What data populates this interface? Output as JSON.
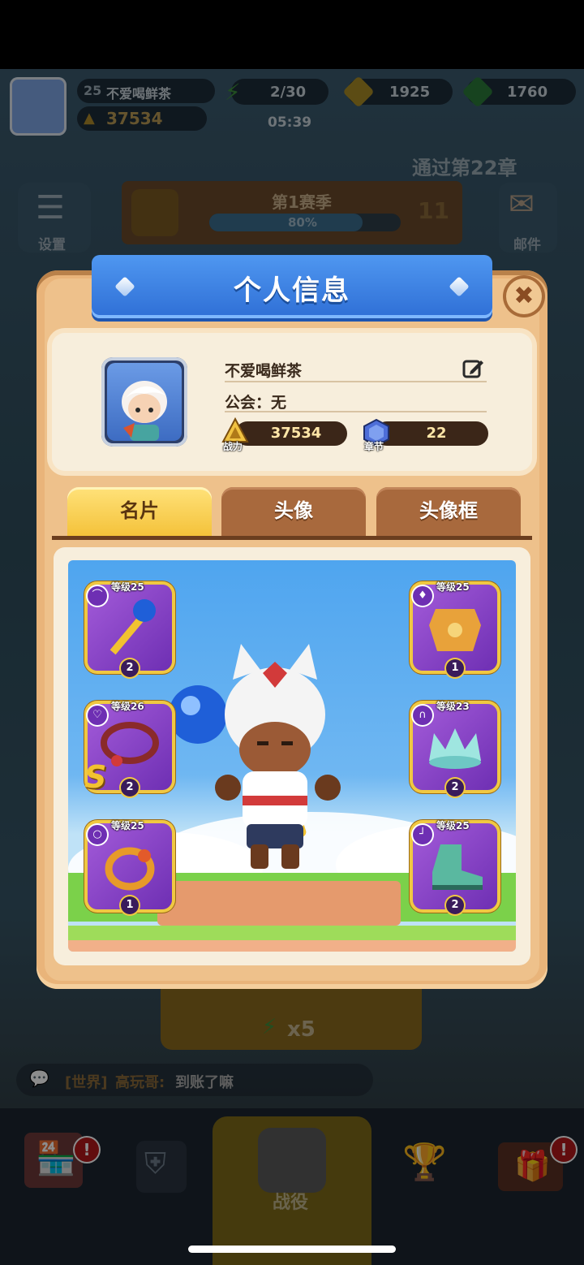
{
  "hud": {
    "level": "25",
    "player_name": "不爱喝鲜茶",
    "power": "37534",
    "stamina": "2/30",
    "stamina_timer": "05:39",
    "gold": "1925",
    "gems": "1760"
  },
  "background": {
    "settings_label": "设置",
    "mail_label": "邮件",
    "season_title": "第1赛季",
    "season_progress": "80%",
    "season_progress_value": 0.8,
    "season_level": "11",
    "quest_text": "通过第22章",
    "chat_channel": "[世界]",
    "chat_user": "高玩哥:",
    "chat_message": "到账了嘛",
    "energy_cost": "x5",
    "battle_label": "战役"
  },
  "modal": {
    "title": "个人信息",
    "close_symbol": "✖",
    "name": "不爱喝鲜茶",
    "guild": "公会：无",
    "power_label": "战力",
    "power_value": "37534",
    "chapter_label": "章节",
    "chapter_value": "22",
    "tabs": [
      {
        "label": "名片",
        "active": true
      },
      {
        "label": "头像",
        "active": false
      },
      {
        "label": "头像框",
        "active": false
      }
    ]
  },
  "equipment": [
    {
      "slot": "weapon",
      "level": "等级25",
      "count": "2",
      "icon": "staff-icon"
    },
    {
      "slot": "necklace",
      "level": "等级26",
      "count": "2",
      "icon": "necklace-icon",
      "grade": "S"
    },
    {
      "slot": "ring",
      "level": "等级25",
      "count": "1",
      "icon": "ring-icon"
    },
    {
      "slot": "armor",
      "level": "等级25",
      "count": "1",
      "icon": "armor-icon"
    },
    {
      "slot": "helmet",
      "level": "等级23",
      "count": "2",
      "icon": "crown-icon"
    },
    {
      "slot": "boots",
      "level": "等级25",
      "count": "2",
      "icon": "boots-icon"
    }
  ],
  "nav": {
    "alert_symbol": "!"
  },
  "colors": {
    "ribbon_blue": "#2f6fd6",
    "tab_active": "#f4c23a",
    "tab_inactive": "#a8693d",
    "slot_purple": "#8a45c8",
    "power_gold": "#ffe6a8"
  }
}
